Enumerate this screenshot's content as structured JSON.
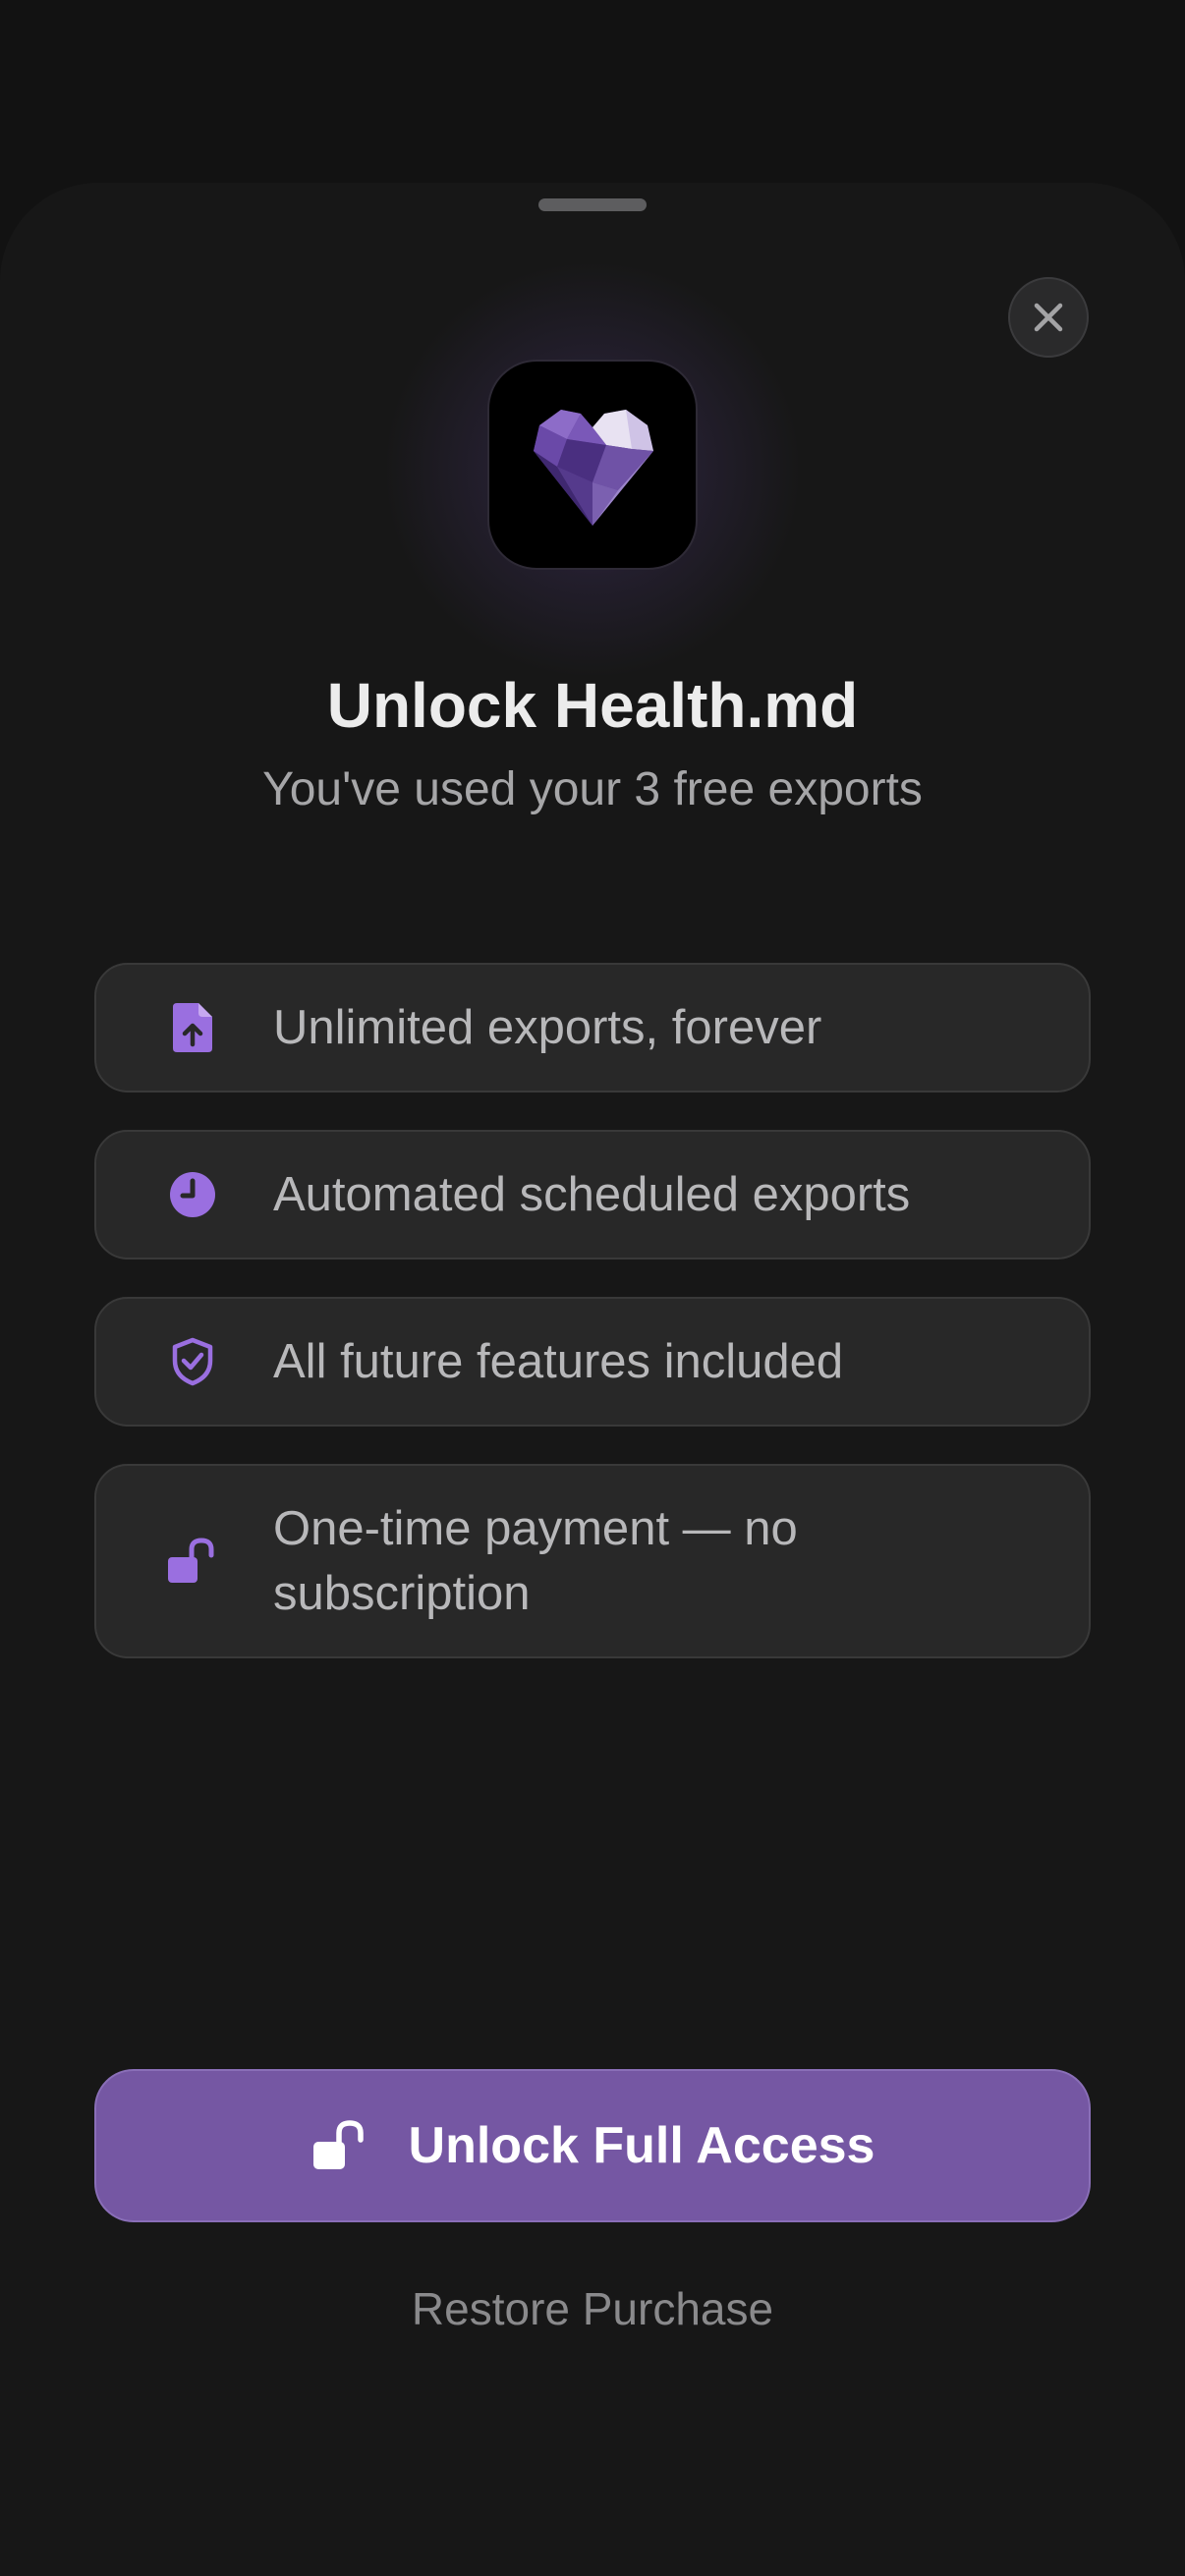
{
  "header": {
    "title": "Unlock Health.md",
    "subtitle": "You've used your 3 free exports",
    "app_icon": "purple-crystal-heart-icon",
    "close_icon": "close-icon"
  },
  "features": [
    {
      "icon": "document-upload-icon",
      "label": "Unlimited exports, forever"
    },
    {
      "icon": "clock-icon",
      "label": "Automated scheduled exports"
    },
    {
      "icon": "shield-check-icon",
      "label": "All future features included"
    },
    {
      "icon": "unlock-icon",
      "label": "One-time payment — no subscription"
    }
  ],
  "actions": {
    "unlock_label": "Unlock Full Access",
    "unlock_icon": "unlock-icon",
    "restore_label": "Restore Purchase"
  },
  "colors": {
    "background": "#121212",
    "sheet": "#171717",
    "card": "#282828",
    "accent": "#7557a3",
    "icon_accent": "#9a6fe0"
  }
}
